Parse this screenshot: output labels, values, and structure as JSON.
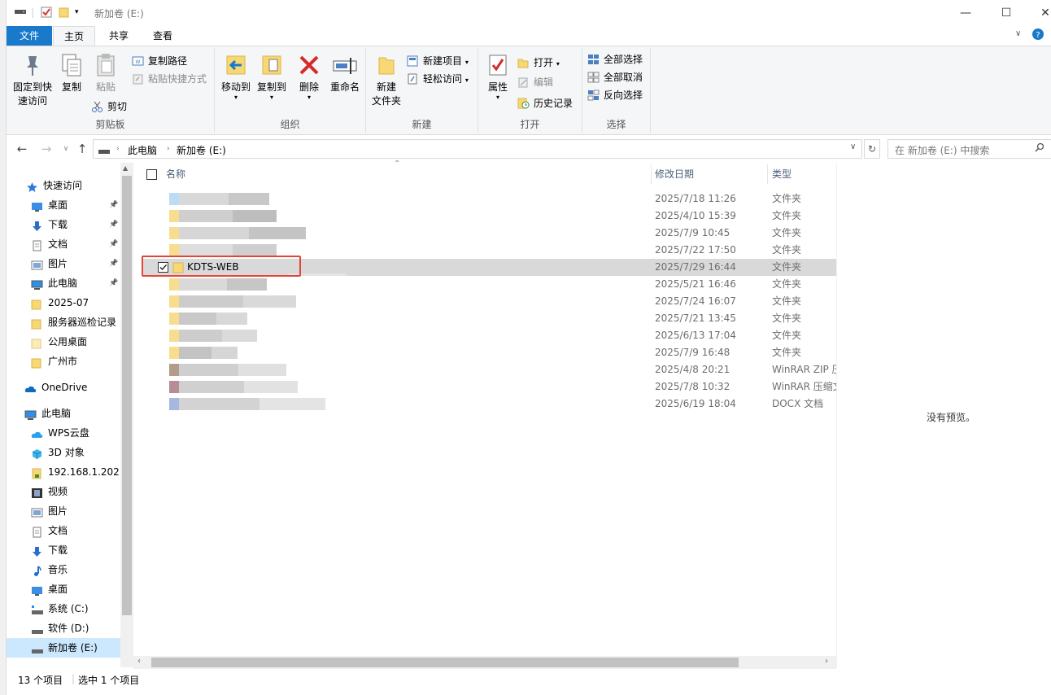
{
  "window": {
    "title": "新加卷 (E:)"
  },
  "tabs": [
    "文件",
    "主页",
    "共享",
    "查看"
  ],
  "ribbon": {
    "clipboard": {
      "label": "剪贴板",
      "pin": "固定到快\n速访问",
      "pin_l1": "固定到快",
      "pin_l2": "速访问",
      "copy": "复制",
      "paste": "粘贴",
      "copy_path": "复制路径",
      "paste_shortcut": "粘贴快捷方式",
      "cut": "剪切"
    },
    "organize": {
      "label": "组织",
      "move_to": "移动到",
      "copy_to": "复制到",
      "delete": "删除",
      "rename": "重命名"
    },
    "new": {
      "label": "新建",
      "new_folder_l1": "新建",
      "new_folder_l2": "文件夹",
      "new_item": "新建项目",
      "easy_access": "轻松访问"
    },
    "open": {
      "label": "打开",
      "properties": "属性",
      "open": "打开",
      "edit": "编辑",
      "history": "历史记录"
    },
    "select": {
      "label": "选择",
      "select_all": "全部选择",
      "select_none": "全部取消",
      "invert": "反向选择"
    }
  },
  "address": {
    "crumbs": [
      "此电脑",
      "新加卷 (E:)"
    ],
    "search_placeholder": "在 新加卷 (E:) 中搜索"
  },
  "nav": {
    "quick_access": "快速访问",
    "quick_items": [
      {
        "label": "桌面",
        "pinned": true
      },
      {
        "label": "下载",
        "pinned": true
      },
      {
        "label": "文档",
        "pinned": true
      },
      {
        "label": "图片",
        "pinned": true
      },
      {
        "label": "此电脑",
        "pinned": true
      },
      {
        "label": "2025-07",
        "pinned": false
      },
      {
        "label": "服务器巡检记录",
        "pinned": false
      },
      {
        "label": "公用桌面",
        "pinned": false
      },
      {
        "label": "广州市",
        "pinned": false
      }
    ],
    "onedrive": "OneDrive",
    "this_pc": "此电脑",
    "pc_items": [
      "WPS云盘",
      "3D 对象",
      "192.168.1.202",
      "视频",
      "图片",
      "文档",
      "下载",
      "音乐",
      "桌面",
      "系统 (C:)",
      "软件 (D:)",
      "新加卷 (E:)"
    ]
  },
  "columns": {
    "name": "名称",
    "date": "修改日期",
    "type": "类型"
  },
  "files": [
    {
      "name": "",
      "date": "2025/7/18 11:26",
      "type": "文件夹"
    },
    {
      "name": "",
      "date": "2025/4/10 15:39",
      "type": "文件夹"
    },
    {
      "name": "",
      "date": "2025/7/9 10:45",
      "type": "文件夹"
    },
    {
      "name": "",
      "date": "2025/7/22 17:50",
      "type": "文件夹"
    },
    {
      "name": "KDTS-WEB",
      "date": "2025/7/29 16:44",
      "type": "文件夹",
      "selected": true
    },
    {
      "name": "",
      "date": "2025/5/21 16:46",
      "type": "文件夹"
    },
    {
      "name": "",
      "date": "2025/7/24 16:07",
      "type": "文件夹"
    },
    {
      "name": "",
      "date": "2025/7/21 13:45",
      "type": "文件夹"
    },
    {
      "name": "",
      "date": "2025/6/13 17:04",
      "type": "文件夹"
    },
    {
      "name": "",
      "date": "2025/7/9 16:48",
      "type": "文件夹"
    },
    {
      "name": "",
      "date": "2025/4/8 20:21",
      "type": "WinRAR ZIP 压缩文件"
    },
    {
      "name": "",
      "date": "2025/7/8 10:32",
      "type": "WinRAR 压缩文件"
    },
    {
      "name": "",
      "date": "2025/6/19 18:04",
      "type": "DOCX 文档"
    }
  ],
  "preview": {
    "message": "没有预览。"
  },
  "status": {
    "count": "13 个项目",
    "selected": "选中 1 个项目"
  },
  "colors": {
    "accent": "#1979ca",
    "selection": "#cce8ff",
    "highlight_box": "#e2463a",
    "folder": "#f8d775"
  }
}
